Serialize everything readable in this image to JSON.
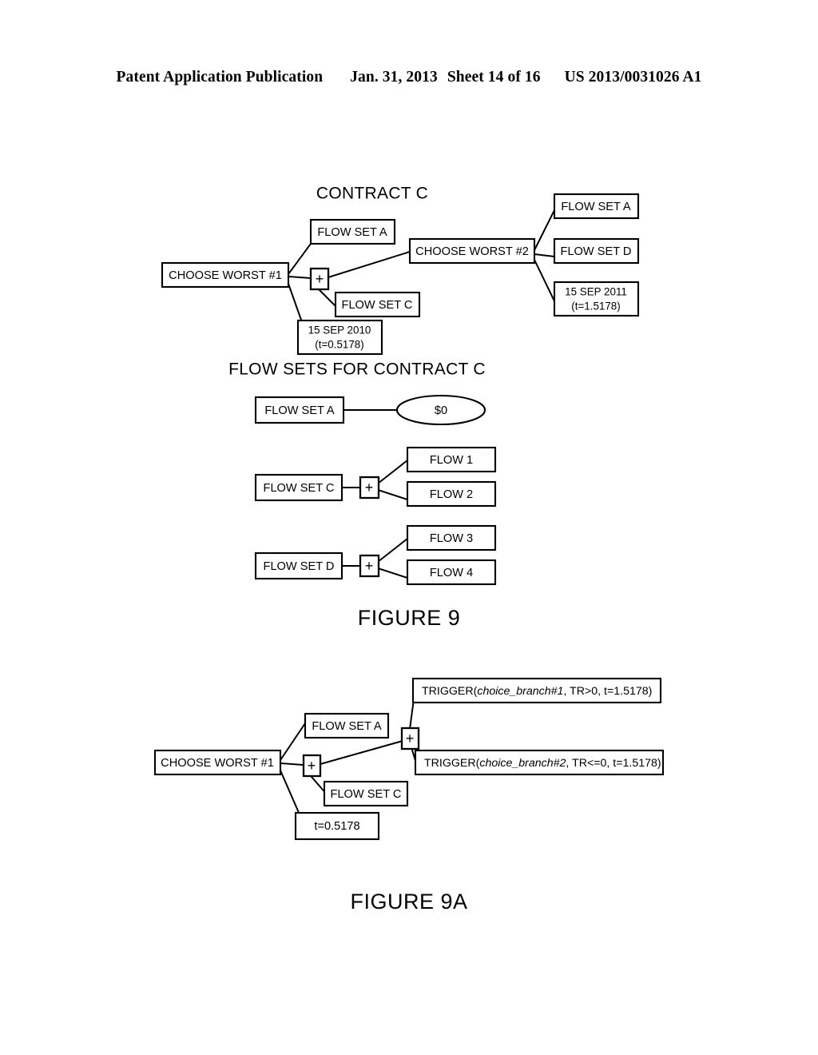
{
  "header": {
    "left": "Patent Application Publication",
    "date": "Jan. 31, 2013",
    "sheet": "Sheet 14 of 16",
    "pub_number": "US 2013/0031026 A1"
  },
  "figure9": {
    "caption": "FIGURE 9",
    "contract_title": "CONTRACT C",
    "flowsets_title": "FLOW SETS FOR CONTRACT C",
    "plus_glyph": "+",
    "contract_tree": {
      "root": "CHOOSE WORST #1",
      "branch_a": "FLOW SET A",
      "branch_c": "FLOW SET C",
      "date_left_line1": "15 SEP 2010",
      "date_left_line2": "(t=0.5178)",
      "second_choice": "CHOOSE WORST #2",
      "right_a": "FLOW SET A",
      "right_d": "FLOW SET D",
      "date_right_line1": "15 SEP 2011",
      "date_right_line2": "(t=1.5178)"
    },
    "flow_sets": [
      {
        "name": "FLOW SET A",
        "value": "$0",
        "children": []
      },
      {
        "name": "FLOW SET C",
        "value": "",
        "children": [
          "FLOW 1",
          "FLOW 2"
        ]
      },
      {
        "name": "FLOW SET D",
        "value": "",
        "children": [
          "FLOW 3",
          "FLOW 4"
        ]
      }
    ]
  },
  "figure9a": {
    "caption": "FIGURE 9A",
    "plus_glyph": "+",
    "root": "CHOOSE WORST #1",
    "branch_a": "FLOW SET A",
    "branch_c": "FLOW SET C",
    "time_label": "t=0.5178",
    "trigger1": {
      "prefix": "TRIGGER(",
      "italic": "choice_branch#1",
      "suffix": ", TR>0, t=1.5178)"
    },
    "trigger2": {
      "prefix": "TRIGGER(",
      "italic": "choice_branch#2",
      "suffix": ", TR<=0, t=1.5178)"
    }
  },
  "colors": {
    "ink": "#000000",
    "paper": "#ffffff"
  }
}
